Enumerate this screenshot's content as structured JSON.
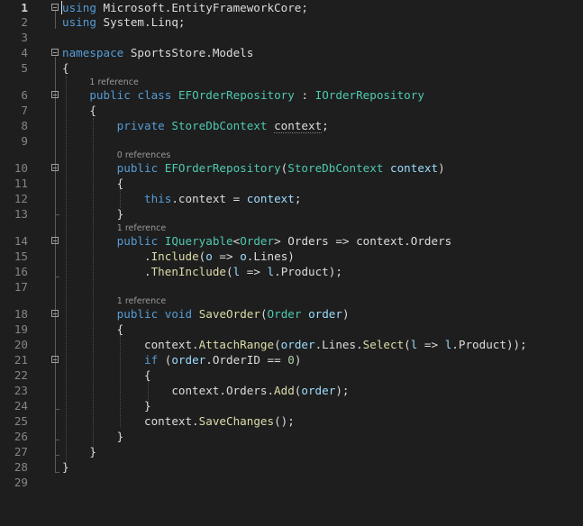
{
  "editor": {
    "current_line": 1,
    "codelens": {
      "l6": "1 reference",
      "l10": "0 references",
      "l14": "1 reference",
      "l18": "1 reference"
    },
    "lines": [
      {
        "n": 1,
        "tokens": [
          [
            "using",
            "kw"
          ],
          [
            " Microsoft.EntityFrameworkCore;",
            "pl"
          ]
        ]
      },
      {
        "n": 2,
        "tokens": [
          [
            "using",
            "kw"
          ],
          [
            " System.Linq;",
            "pl"
          ]
        ]
      },
      {
        "n": 3,
        "tokens": []
      },
      {
        "n": 4,
        "tokens": [
          [
            "namespace",
            "kw"
          ],
          [
            " SportsStore.Models",
            "pl"
          ]
        ]
      },
      {
        "n": 5,
        "tokens": [
          [
            "{",
            "pl"
          ]
        ]
      },
      {
        "n": 6,
        "tokens": [
          [
            "    ",
            "pl"
          ],
          [
            "public",
            "kw"
          ],
          [
            " ",
            "pl"
          ],
          [
            "class",
            "kw"
          ],
          [
            " ",
            "pl"
          ],
          [
            "EFOrderRepository",
            "ty"
          ],
          [
            " : ",
            "pl"
          ],
          [
            "IOrderRepository",
            "ty"
          ]
        ]
      },
      {
        "n": 7,
        "tokens": [
          [
            "    {",
            "pl"
          ]
        ]
      },
      {
        "n": 8,
        "tokens": [
          [
            "        ",
            "pl"
          ],
          [
            "private",
            "kw"
          ],
          [
            " ",
            "pl"
          ],
          [
            "StoreDbContext",
            "ty"
          ],
          [
            " ",
            "pl"
          ],
          [
            "context",
            "pl",
            "squig"
          ],
          [
            ";",
            "pl"
          ]
        ]
      },
      {
        "n": 9,
        "tokens": []
      },
      {
        "n": 10,
        "tokens": [
          [
            "        ",
            "pl"
          ],
          [
            "public",
            "kw"
          ],
          [
            " ",
            "pl"
          ],
          [
            "EFOrderRepository",
            "ty"
          ],
          [
            "(",
            "pl"
          ],
          [
            "StoreDbContext",
            "ty"
          ],
          [
            " ",
            "pl"
          ],
          [
            "context",
            "id"
          ],
          [
            ")",
            "pl"
          ]
        ]
      },
      {
        "n": 11,
        "tokens": [
          [
            "        {",
            "pl"
          ]
        ]
      },
      {
        "n": 12,
        "tokens": [
          [
            "            ",
            "pl"
          ],
          [
            "this",
            "kw"
          ],
          [
            ".context = ",
            "pl"
          ],
          [
            "context",
            "id"
          ],
          [
            ";",
            "pl"
          ]
        ]
      },
      {
        "n": 13,
        "tokens": [
          [
            "        }",
            "pl"
          ]
        ]
      },
      {
        "n": 14,
        "tokens": [
          [
            "        ",
            "pl"
          ],
          [
            "public",
            "kw"
          ],
          [
            " ",
            "pl"
          ],
          [
            "IQueryable",
            "ty"
          ],
          [
            "<",
            "pl"
          ],
          [
            "Order",
            "ty"
          ],
          [
            "> Orders => context.Orders",
            "pl"
          ]
        ]
      },
      {
        "n": 15,
        "tokens": [
          [
            "            .",
            "pl"
          ],
          [
            "Include",
            "fn"
          ],
          [
            "(",
            "pl"
          ],
          [
            "o",
            "id"
          ],
          [
            " => ",
            "pl"
          ],
          [
            "o",
            "id"
          ],
          [
            ".Lines)",
            "pl"
          ]
        ]
      },
      {
        "n": 16,
        "tokens": [
          [
            "            .",
            "pl"
          ],
          [
            "ThenInclude",
            "fn"
          ],
          [
            "(",
            "pl"
          ],
          [
            "l",
            "id"
          ],
          [
            " => ",
            "pl"
          ],
          [
            "l",
            "id"
          ],
          [
            ".Product);",
            "pl"
          ]
        ]
      },
      {
        "n": 17,
        "tokens": []
      },
      {
        "n": 18,
        "tokens": [
          [
            "        ",
            "pl"
          ],
          [
            "public",
            "kw"
          ],
          [
            " ",
            "pl"
          ],
          [
            "void",
            "kw"
          ],
          [
            " ",
            "pl"
          ],
          [
            "SaveOrder",
            "fn"
          ],
          [
            "(",
            "pl"
          ],
          [
            "Order",
            "ty"
          ],
          [
            " ",
            "pl"
          ],
          [
            "order",
            "id"
          ],
          [
            ")",
            "pl"
          ]
        ]
      },
      {
        "n": 19,
        "tokens": [
          [
            "        {",
            "pl"
          ]
        ]
      },
      {
        "n": 20,
        "tokens": [
          [
            "            context.",
            "pl"
          ],
          [
            "AttachRange",
            "fn"
          ],
          [
            "(",
            "pl"
          ],
          [
            "order",
            "id"
          ],
          [
            ".Lines.",
            "pl"
          ],
          [
            "Select",
            "fn"
          ],
          [
            "(",
            "pl"
          ],
          [
            "l",
            "id"
          ],
          [
            " => ",
            "pl"
          ],
          [
            "l",
            "id"
          ],
          [
            ".Product));",
            "pl"
          ]
        ]
      },
      {
        "n": 21,
        "tokens": [
          [
            "            ",
            "pl"
          ],
          [
            "if",
            "kw"
          ],
          [
            " (",
            "pl"
          ],
          [
            "order",
            "id"
          ],
          [
            ".OrderID == ",
            "pl"
          ],
          [
            "0",
            "lit"
          ],
          [
            ")",
            "pl"
          ]
        ]
      },
      {
        "n": 22,
        "tokens": [
          [
            "            {",
            "pl"
          ]
        ]
      },
      {
        "n": 23,
        "tokens": [
          [
            "                context.Orders.",
            "pl"
          ],
          [
            "Add",
            "fn"
          ],
          [
            "(",
            "pl"
          ],
          [
            "order",
            "id"
          ],
          [
            ");",
            "pl"
          ]
        ]
      },
      {
        "n": 24,
        "tokens": [
          [
            "            }",
            "pl"
          ]
        ]
      },
      {
        "n": 25,
        "tokens": [
          [
            "            context.",
            "pl"
          ],
          [
            "SaveChanges",
            "fn"
          ],
          [
            "();",
            "pl"
          ]
        ]
      },
      {
        "n": 26,
        "tokens": [
          [
            "        }",
            "pl"
          ]
        ]
      },
      {
        "n": 27,
        "tokens": [
          [
            "    }",
            "pl"
          ]
        ]
      },
      {
        "n": 28,
        "tokens": [
          [
            "}",
            "pl"
          ]
        ]
      },
      {
        "n": 29,
        "tokens": []
      }
    ]
  }
}
